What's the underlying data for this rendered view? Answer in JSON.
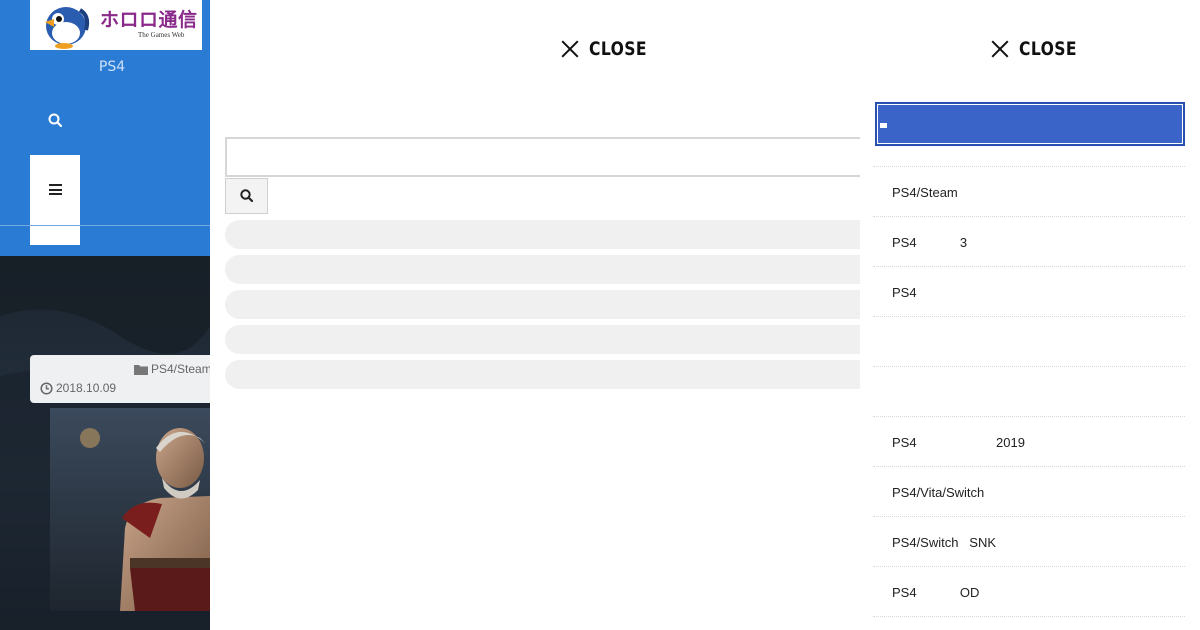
{
  "site": {
    "logo_title": "ホロロ通信",
    "logo_subtitle": "The Games Web",
    "nav_label": "PS4",
    "post": {
      "category": "PS4/Steam",
      "date": "2018.10.09"
    }
  },
  "search_overlay": {
    "close_label": "CLOSE",
    "input_value": "",
    "input_placeholder": ""
  },
  "menu_overlay": {
    "close_label": "CLOSE",
    "items": [
      {
        "label": "PS4/Steam"
      },
      {
        "label": "PS4            3"
      },
      {
        "label": "PS4"
      },
      {
        "label": ""
      },
      {
        "label": ""
      },
      {
        "label": "PS4                      2019"
      },
      {
        "label": "PS4/Vita/Switch"
      },
      {
        "label": "PS4/Switch   SNK"
      },
      {
        "label": "PS4            OD"
      }
    ]
  },
  "colors": {
    "header_blue": "#2a7bd3",
    "selected_item": "#3a64c8"
  }
}
